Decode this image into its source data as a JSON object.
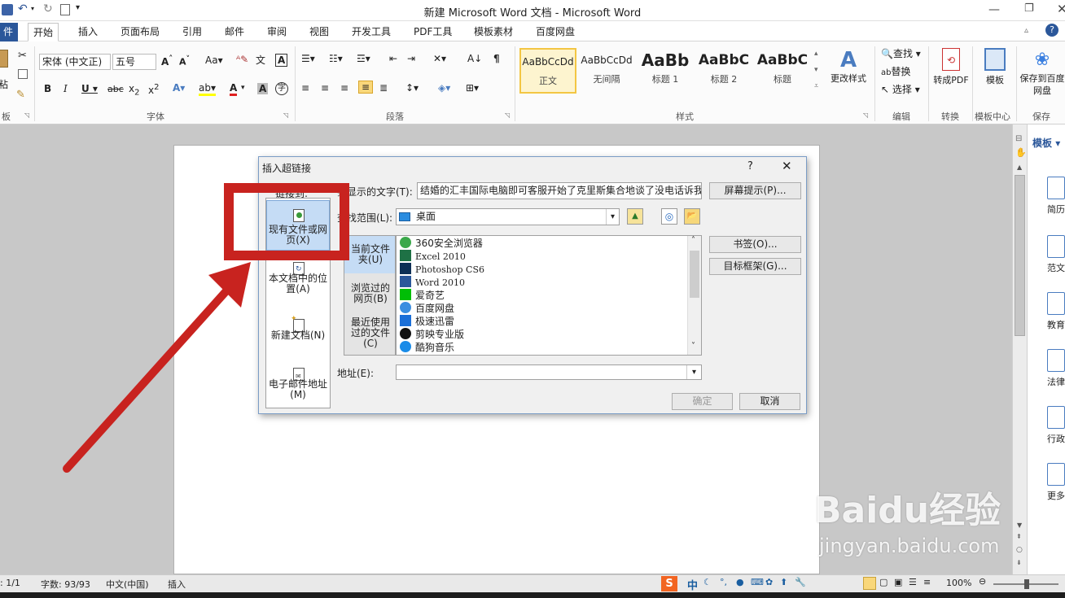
{
  "window": {
    "title": "新建 Microsoft Word 文档 - Microsoft Word"
  },
  "tabs": [
    "件",
    "开始",
    "插入",
    "页面布局",
    "引用",
    "邮件",
    "审阅",
    "视图",
    "开发工具",
    "PDF工具",
    "模板素材",
    "百度网盘"
  ],
  "ribbon": {
    "clipboard": {
      "paste": "粘",
      "group": "板"
    },
    "font": {
      "name": "宋体 (中文正)",
      "size": "五号",
      "group": "字体"
    },
    "paragraph": {
      "group": "段落"
    },
    "styles": {
      "items": [
        {
          "preview": "AaBbCcDd",
          "name": "正文"
        },
        {
          "preview": "AaBbCcDd",
          "name": "无间隔"
        },
        {
          "preview": "AaBb",
          "name": "标题 1"
        },
        {
          "preview": "AaBbC",
          "name": "标题 2"
        },
        {
          "preview": "AaBbC",
          "name": "标题"
        }
      ],
      "change": "更改样式",
      "group": "样式"
    },
    "editing": {
      "find": "查找",
      "replace": "替换",
      "select": "选择",
      "group": "编辑"
    },
    "convert": {
      "label": "转成PDF",
      "group": "转换"
    },
    "template": {
      "label": "模板",
      "group": "模板中心"
    },
    "save": {
      "label": "保存到百度网盘",
      "group": "保存"
    }
  },
  "dialog": {
    "title": "插入超链接",
    "help": "?",
    "link_to_label": "链接到:",
    "link_targets": [
      "现有文件或网页(X)",
      "本文档中的位置(A)",
      "新建文档(N)",
      "电子邮件地址(M)"
    ],
    "display_text_label": "要显示的文字(T):",
    "display_text_value": "结婚的汇丰国际电脑即可客服开始了克里斯集合地谈了没电话诉我",
    "screen_tip_button": "屏幕提示(P)...",
    "look_in_label": "查找范围(L):",
    "look_in_value": "桌面",
    "side_tabs": [
      "当前文件夹(U)",
      "浏览过的网页(B)",
      "最近使用过的文件(C)"
    ],
    "files": [
      "360安全浏览器",
      "Excel 2010",
      "Photoshop CS6",
      "Word 2010",
      "爱奇艺",
      "百度网盘",
      "极速迅雷",
      "剪映专业版",
      "酷狗音乐"
    ],
    "bookmark_button": "书签(O)...",
    "target_frame_button": "目标框架(G)...",
    "address_label": "地址(E):",
    "address_value": "",
    "ok_button": "确定",
    "cancel_button": "取消"
  },
  "taskpane": {
    "title": "模板",
    "items": [
      "简历",
      "范文",
      "教育",
      "法律",
      "行政",
      "更多"
    ]
  },
  "status": {
    "page": ": 1/1",
    "words": "字数: 93/93",
    "language": "中文(中国)",
    "mode": "插入",
    "zoom": "100%",
    "ime": "中"
  },
  "watermark": {
    "brand": "Baidu经验",
    "url": "jingyan.baidu.com"
  },
  "colors": {
    "highlight": "#c8231f",
    "accent": "#2b579a",
    "selected": "#c5dcf5"
  }
}
